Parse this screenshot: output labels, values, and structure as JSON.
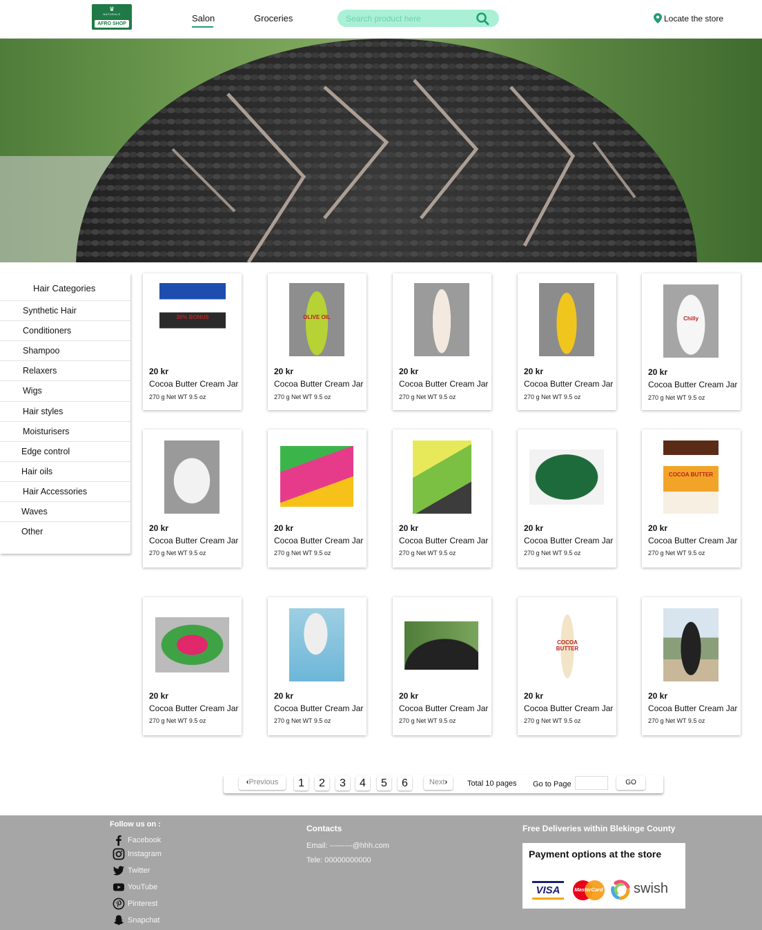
{
  "header": {
    "logo": {
      "top_text": "NATURALS",
      "name": "AFRO SHOP",
      "icon": "crown-icon"
    },
    "nav": [
      {
        "label": "Salon",
        "active": true
      },
      {
        "label": "Groceries",
        "active": false
      }
    ],
    "search": {
      "placeholder": "Search product here",
      "icon": "search-icon"
    },
    "locate": {
      "label": "Locate the store",
      "icon": "map-pin-icon"
    },
    "accent_color": "#1f9e6e",
    "search_bg_color": "#a9f0d6"
  },
  "hero": {
    "image": "braided-hair-photo"
  },
  "sidebar": {
    "title": "Hair Categories",
    "items": [
      {
        "label": "Synthetic Hair"
      },
      {
        "label": "Conditioners"
      },
      {
        "label": "Shampoo"
      },
      {
        "label": "Relaxers"
      },
      {
        "label": "Wigs"
      },
      {
        "label": "Hair styles"
      },
      {
        "label": "Moisturisers"
      },
      {
        "label": "Edge control"
      },
      {
        "label": "Hair oils"
      },
      {
        "label": "Hair Accessories"
      },
      {
        "label": "Waves"
      },
      {
        "label": "Other"
      }
    ]
  },
  "products": [
    {
      "image": "cocoa-butter-jar",
      "price": "20 kr",
      "name": "Cocoa Butter Cream Jar",
      "weight": "270 g Net WT 9.5 oz",
      "image_label": "30% BONUS"
    },
    {
      "image": "olive-oil-bottle",
      "price": "20 kr",
      "name": "Cocoa Butter Cream Jar",
      "weight": "270 g Net WT 9.5 oz",
      "image_label": "OLIVE OIL"
    },
    {
      "image": "cream-tube",
      "price": "20 kr",
      "name": "Cocoa Butter Cream Jar",
      "weight": "270 g Net WT 9.5 oz"
    },
    {
      "image": "yellow-spray-bottle",
      "price": "20 kr",
      "name": "Cocoa Butter Cream Jar",
      "weight": "270 g Net WT 9.5 oz"
    },
    {
      "image": "chilly-bottle",
      "price": "20 kr",
      "name": "Cocoa Butter Cream Jar",
      "weight": "270 g Net WT 9.5 oz",
      "image_label": "Chilly"
    },
    {
      "image": "white-jar",
      "price": "20 kr",
      "name": "Cocoa Butter Cream Jar",
      "weight": "270 g Net WT 9.5 oz"
    },
    {
      "image": "kids-relaxer-box",
      "price": "20 kr",
      "name": "Cocoa Butter Cream Jar",
      "weight": "270 g Net WT 9.5 oz"
    },
    {
      "image": "organics-relaxer-box",
      "price": "20 kr",
      "name": "Cocoa Butter Cream Jar",
      "weight": "270 g Net WT 9.5 oz"
    },
    {
      "image": "blue-magic-jar",
      "price": "20 kr",
      "name": "Cocoa Butter Cream Jar",
      "weight": "270 g Net WT 9.5 oz"
    },
    {
      "image": "queen-helene-cocoa-butter-jar",
      "price": "20 kr",
      "name": "Cocoa Butter Cream Jar",
      "weight": "270 g Net WT 9.5 oz",
      "image_label": "COCOA BUTTER"
    },
    {
      "image": "green-pink-jar",
      "price": "20 kr",
      "name": "Cocoa Butter Cream Jar",
      "weight": "270 g Net WT 9.5 oz"
    },
    {
      "image": "woman-white-braids-photo",
      "price": "20 kr",
      "name": "Cocoa Butter Cream Jar",
      "weight": "270 g Net WT 9.5 oz"
    },
    {
      "image": "braided-hair-photo",
      "price": "20 kr",
      "name": "Cocoa Butter Cream Jar",
      "weight": "270 g Net WT 9.5 oz"
    },
    {
      "image": "cocoa-butter-lotion-bottle",
      "price": "20 kr",
      "name": "Cocoa Butter Cream Jar",
      "weight": "270 g Net WT 9.5 oz",
      "image_label": "COCOA BUTTER"
    },
    {
      "image": "woman-braids-road-photo",
      "price": "20 kr",
      "name": "Cocoa Butter Cream Jar",
      "weight": "270 g Net WT 9.5 oz"
    }
  ],
  "pagination": {
    "previous": "Previous",
    "next": "Next",
    "pages": [
      "1",
      "2",
      "3",
      "4",
      "5",
      "6"
    ],
    "total": "Total 10 pages",
    "goto_label": "Go to Page",
    "goto_value": "",
    "go_button": "GO"
  },
  "footer": {
    "follow_title": "Follow us on :",
    "social": [
      {
        "label": "Facebook",
        "icon": "facebook-icon"
      },
      {
        "label": "Instagram",
        "icon": "instagram-icon"
      },
      {
        "label": "Twitter",
        "icon": "twitter-icon"
      },
      {
        "label": "YouTube",
        "icon": "youtube-icon"
      },
      {
        "label": "Pinterest",
        "icon": "pinterest-icon"
      },
      {
        "label": "Snapchat",
        "icon": "snapchat-icon"
      }
    ],
    "contacts_title": "Contacts",
    "email": "Email: ---------@hhh.com",
    "tele": "Tele: 00000000000",
    "deliveries": "Free Deliveries within Blekinge County",
    "payment_title": "Payment options at the store",
    "payment_methods": [
      "VISA",
      "MasterCard",
      "swish"
    ],
    "bg_color": "#a6a6a6"
  }
}
